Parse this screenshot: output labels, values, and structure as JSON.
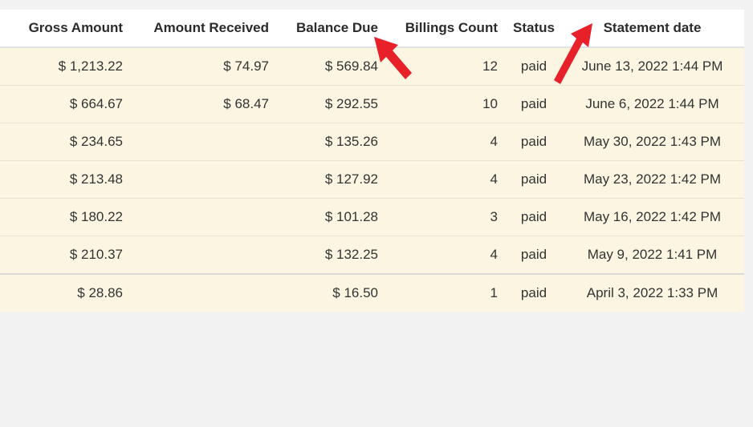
{
  "table": {
    "headers": {
      "gross_amount": "Gross Amount",
      "amount_received": "Amount Received",
      "balance_due": "Balance Due",
      "billings_count": "Billings Count",
      "status": "Status",
      "statement_date": "Statement date"
    },
    "rows": [
      {
        "gross": "$ 1,213.22",
        "received": "$ 74.97",
        "balance": "$ 569.84",
        "count": "12",
        "status": "paid",
        "date": "June 13, 2022 1:44 PM"
      },
      {
        "gross": "$ 664.67",
        "received": "$ 68.47",
        "balance": "$ 292.55",
        "count": "10",
        "status": "paid",
        "date": "June 6, 2022 1:44 PM"
      },
      {
        "gross": "$ 234.65",
        "received": "",
        "balance": "$ 135.26",
        "count": "4",
        "status": "paid",
        "date": "May 30, 2022 1:43 PM"
      },
      {
        "gross": "$ 213.48",
        "received": "",
        "balance": "$ 127.92",
        "count": "4",
        "status": "paid",
        "date": "May 23, 2022 1:42 PM"
      },
      {
        "gross": "$ 180.22",
        "received": "",
        "balance": "$ 101.28",
        "count": "3",
        "status": "paid",
        "date": "May 16, 2022 1:42 PM"
      },
      {
        "gross": "$ 210.37",
        "received": "",
        "balance": "$ 132.25",
        "count": "4",
        "status": "paid",
        "date": "May 9, 2022 1:41 PM"
      },
      {
        "gross": "$ 28.86",
        "received": "",
        "balance": "$ 16.50",
        "count": "1",
        "status": "paid",
        "date": "April 3, 2022 1:33 PM"
      }
    ]
  },
  "annotations": {
    "arrow_color": "#e8202a",
    "arrow_icon": "red-arrow-icon"
  }
}
